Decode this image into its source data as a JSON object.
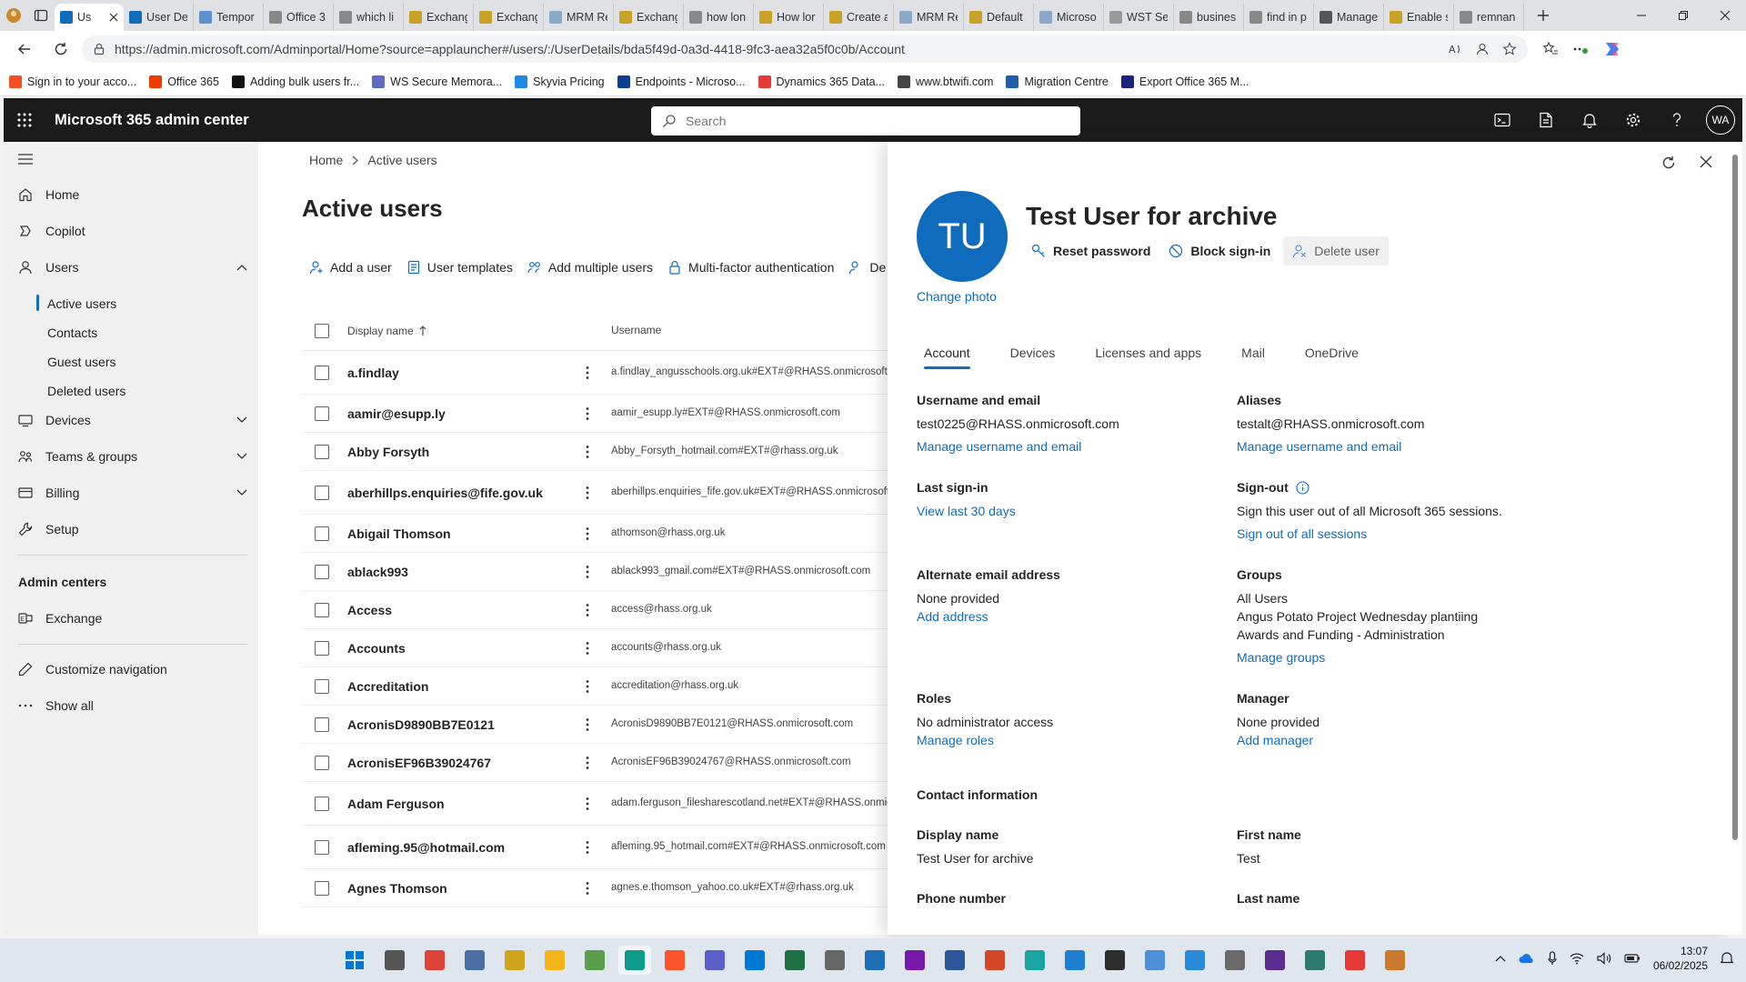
{
  "browser": {
    "tabs": [
      "Us",
      "User De",
      "Tempor",
      "Office 3",
      "which li",
      "Exchang",
      "Exchang",
      "MRM Re",
      "Exchang",
      "how lon",
      "How lor",
      "Create a",
      "MRM Re",
      "Default",
      "Microso",
      "WST Se",
      "busines",
      "find in p",
      "Manage",
      "Enable s",
      "remnan"
    ],
    "url": "https://admin.microsoft.com/Adminportal/Home?source=applauncher#/users/:/UserDetails/bda5f49d-0a3d-4418-9fc3-aea32a5f0c0b/Account",
    "favorites": [
      "Sign in to your acco...",
      "Office 365",
      "Adding bulk users fr...",
      "WS Secure Memora...",
      "Skyvia Pricing",
      "Endpoints - Microso...",
      "Dynamics 365 Data...",
      "www.btwifi.com",
      "Migration Centre",
      "Export Office 365 M..."
    ]
  },
  "header": {
    "app_title": "Microsoft 365 admin center",
    "search_placeholder": "Search",
    "avatar_initials": "WA"
  },
  "nav": {
    "home": "Home",
    "copilot": "Copilot",
    "users": "Users",
    "users_sub": [
      "Active users",
      "Contacts",
      "Guest users",
      "Deleted users"
    ],
    "devices": "Devices",
    "teams_groups": "Teams & groups",
    "billing": "Billing",
    "setup": "Setup",
    "admin_centers": "Admin centers",
    "exchange": "Exchange",
    "customize": "Customize navigation",
    "show_all": "Show all"
  },
  "main": {
    "breadcrumb": [
      "Home",
      "Active users"
    ],
    "title": "Active users",
    "commands": [
      "Add a user",
      "User templates",
      "Add multiple users",
      "Multi-factor authentication",
      "De"
    ],
    "columns": {
      "display_name": "Display name",
      "username": "Username"
    },
    "rows": [
      {
        "name": "a.findlay",
        "user": "a.findlay_angusschools.org.uk#EXT#@RHASS.onmicrosoft.com"
      },
      {
        "name": "aamir@esupp.ly",
        "user": "aamir_esupp.ly#EXT#@RHASS.onmicrosoft.com"
      },
      {
        "name": "Abby Forsyth",
        "user": "Abby_Forsyth_hotmail.com#EXT#@rhass.org.uk"
      },
      {
        "name": "aberhillps.enquiries@fife.gov.uk",
        "user": "aberhillps.enquiries_fife.gov.uk#EXT#@RHASS.onmicrosoft.com"
      },
      {
        "name": "Abigail Thomson",
        "user": "athomson@rhass.org.uk"
      },
      {
        "name": "ablack993",
        "user": "ablack993_gmail.com#EXT#@RHASS.onmicrosoft.com"
      },
      {
        "name": "Access",
        "user": "access@rhass.org.uk"
      },
      {
        "name": "Accounts",
        "user": "accounts@rhass.org.uk"
      },
      {
        "name": "Accreditation",
        "user": "accreditation@rhass.org.uk"
      },
      {
        "name": "AcronisD9890BB7E0121",
        "user": "AcronisD9890BB7E0121@RHASS.onmicrosoft.com"
      },
      {
        "name": "AcronisEF96B39024767",
        "user": "AcronisEF96B39024767@RHASS.onmicrosoft.com"
      },
      {
        "name": "Adam Ferguson",
        "user": "adam.ferguson_filesharescotland.net#EXT#@RHASS.onmicrosoft.com"
      },
      {
        "name": "afleming.95@hotmail.com",
        "user": "afleming.95_hotmail.com#EXT#@RHASS.onmicrosoft.com"
      },
      {
        "name": "Agnes Thomson",
        "user": "agnes.e.thomson_yahoo.co.uk#EXT#@rhass.org.uk"
      }
    ]
  },
  "panel": {
    "initials": "TU",
    "change_photo": "Change photo",
    "user_name": "Test User for archive",
    "actions": [
      "Reset password",
      "Block sign-in",
      "Delete user"
    ],
    "tabs": [
      "Account",
      "Devices",
      "Licenses and apps",
      "Mail",
      "OneDrive"
    ],
    "username_email": {
      "label": "Username and email",
      "value": "test0225@RHASS.onmicrosoft.com",
      "link": "Manage username and email"
    },
    "aliases": {
      "label": "Aliases",
      "value": "testalt@RHASS.onmicrosoft.com",
      "link": "Manage username and email"
    },
    "last_signin": {
      "label": "Last sign-in",
      "link": "View last 30 days"
    },
    "signout": {
      "label": "Sign-out",
      "value": "Sign this user out of all Microsoft 365 sessions.",
      "link": "Sign out of all sessions"
    },
    "alt_email": {
      "label": "Alternate email address",
      "value": "None provided",
      "link": "Add address"
    },
    "groups": {
      "label": "Groups",
      "values": [
        "All Users",
        "Angus Potato Project Wednesday plantiing",
        "Awards and Funding - Administration"
      ],
      "link": "Manage groups"
    },
    "roles": {
      "label": "Roles",
      "value": "No administrator access",
      "link": "Manage roles"
    },
    "manager": {
      "label": "Manager",
      "value": "None provided",
      "link": "Add manager"
    },
    "contact_heading": "Contact information",
    "display_name": {
      "label": "Display name",
      "value": "Test User for archive"
    },
    "first_name": {
      "label": "First name",
      "value": "Test"
    },
    "phone": {
      "label": "Phone number"
    },
    "last_name": {
      "label": "Last name"
    }
  },
  "taskbar": {
    "time": "13:07",
    "date": "06/02/2025"
  },
  "colors": {
    "accent": "#0f6cbd",
    "header_bg": "#1b1b1b"
  }
}
